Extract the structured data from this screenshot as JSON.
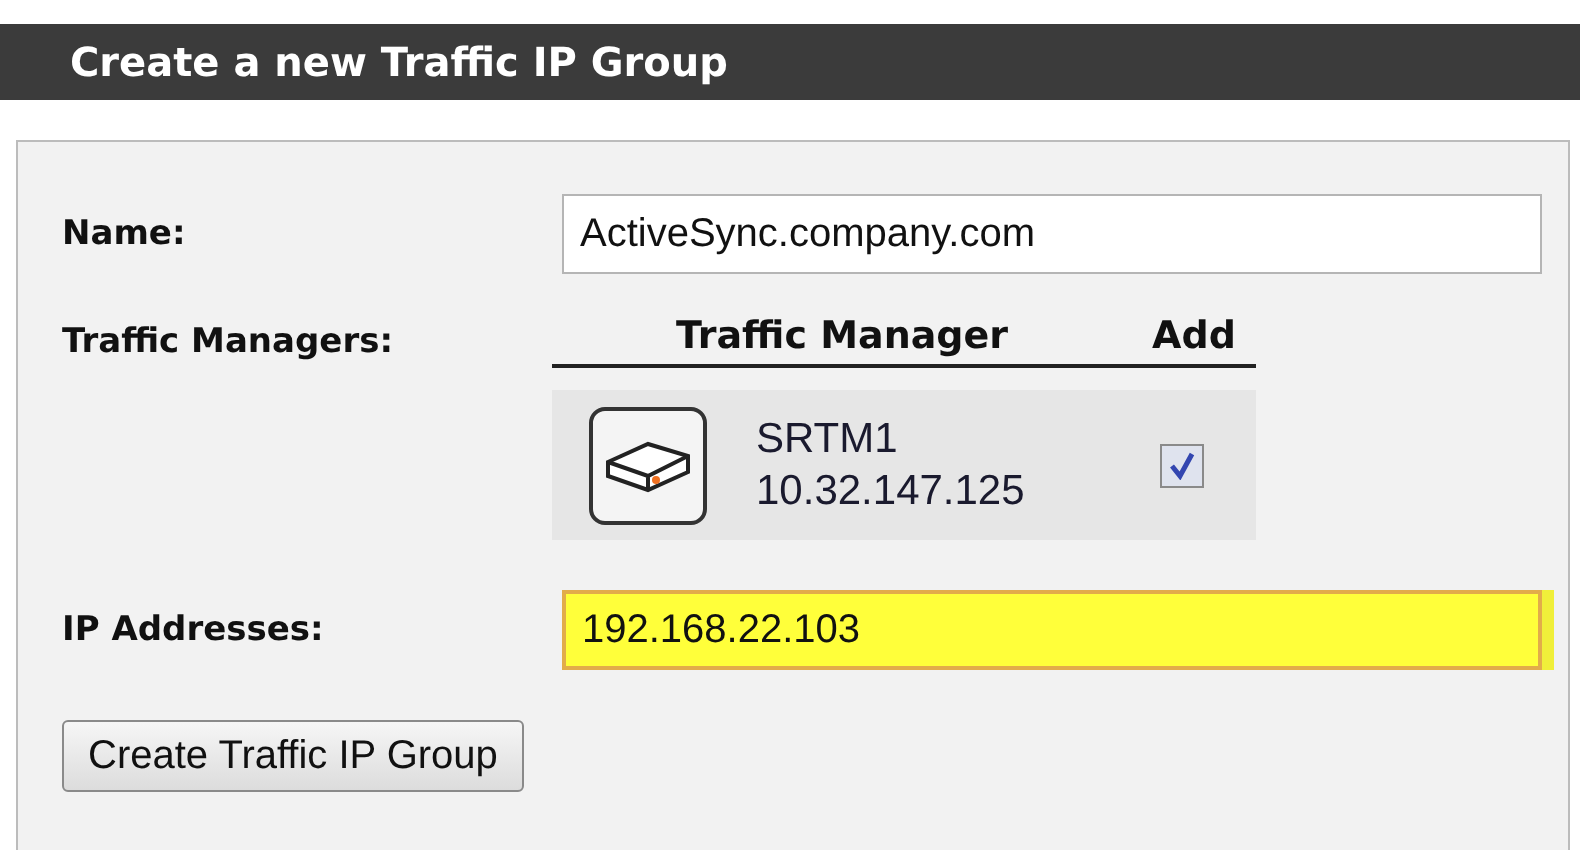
{
  "header": {
    "title": "Create a new Traffic IP Group"
  },
  "form": {
    "name": {
      "label": "Name:",
      "value": "ActiveSync.company.com",
      "focused": false
    },
    "traffic_managers": {
      "label": "Traffic Managers:",
      "columns": [
        "Traffic Manager",
        "Add"
      ],
      "rows": [
        {
          "name": "SRTM1",
          "address": "10.32.147.125",
          "checked": true
        }
      ]
    },
    "ip_addresses": {
      "label": "IP Addresses:",
      "value": "192.168.22.103",
      "focused": true
    },
    "submit": "Create Traffic IP Group"
  }
}
